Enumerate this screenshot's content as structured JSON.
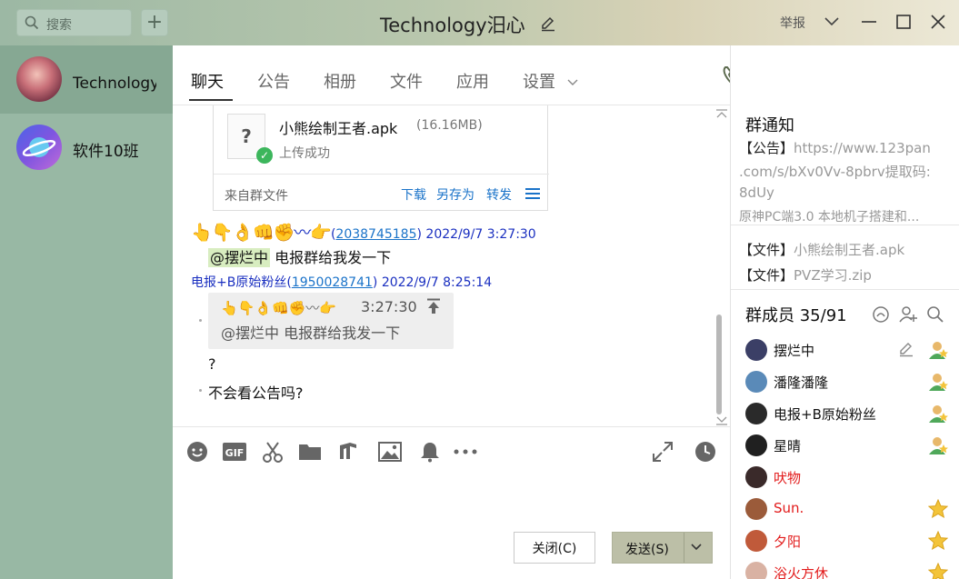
{
  "window": {
    "title": "Technology汨心",
    "report_label": "举报"
  },
  "search": {
    "placeholder": "搜索"
  },
  "sidebar": {
    "items": [
      {
        "name": "Technology汨心"
      },
      {
        "name": "软件10班"
      }
    ]
  },
  "tabs": [
    {
      "label": "聊天"
    },
    {
      "label": "公告"
    },
    {
      "label": "相册"
    },
    {
      "label": "文件"
    },
    {
      "label": "应用"
    },
    {
      "label": "设置"
    }
  ],
  "file_message": {
    "file_name": "小熊绘制王者.apk",
    "file_size": "(16.16MB)",
    "status": "上传成功",
    "source": "来自群文件",
    "actions": [
      "下载",
      "另存为",
      "转发"
    ]
  },
  "messages": [
    {
      "sender_emoji": "👆👇👌👊✊〰👉",
      "uid": "2038745185",
      "time": "2022/9/7 3:27:30",
      "mention": "@摆烂中",
      "text": "电报群给我发一下"
    },
    {
      "sender": "电报+B原始粉丝",
      "uid": "1950028741",
      "time": "2022/9/7 8:25:14",
      "quote": {
        "head": "👆👇👌👊✊〰👉",
        "time": "3:27:30",
        "text": "@摆烂中 电报群给我发一下"
      },
      "lines": [
        "?",
        "不会看公告吗?"
      ]
    }
  ],
  "input": {
    "close_label": "关闭(C)",
    "send_label": "发送(S)"
  },
  "right_panel": {
    "notice_title": "群通知",
    "notice_lines": [
      {
        "tag": "【公告】",
        "text": "https://www.123pan"
      },
      {
        "tag": "",
        "text": ".com/s/bXv0Vv-8pbrv提取码:"
      },
      {
        "tag": "",
        "text": "8dUy"
      },
      {
        "tag": "",
        "text": "原神PC端3.0 本地机子搭建和..."
      }
    ],
    "files": [
      {
        "tag": "【文件】",
        "text": "小熊绘制王者.apk"
      },
      {
        "tag": "【文件】",
        "text": "PVZ学习.zip"
      }
    ],
    "members_title": "群成员 35/91",
    "members": [
      {
        "name": "摆烂中",
        "color": "#111111",
        "badge": "admin-icon"
      },
      {
        "name": "潘隆潘隆",
        "color": "#111111",
        "badge": "admin-icon"
      },
      {
        "name": "电报+B原始粉丝",
        "color": "#111111",
        "badge": "admin-icon"
      },
      {
        "name": "星晴",
        "color": "#111111",
        "badge": "admin-icon"
      },
      {
        "name": "吠物",
        "color": "#e21b1b",
        "badge": ""
      },
      {
        "name": "Sun.",
        "color": "#e21b1b",
        "badge": "star-icon"
      },
      {
        "name": "夕阳",
        "color": "#e21b1b",
        "badge": "star-icon"
      },
      {
        "name": "浴火方休",
        "color": "#e21b1b",
        "badge": "star-icon"
      }
    ]
  },
  "colors": {
    "sidebar_bg": "#98b8a4",
    "sidebar_active": "#86a893",
    "link_blue": "#1a73c9",
    "send_button": "#bcbfa7",
    "member_red": "#e21b1b"
  }
}
